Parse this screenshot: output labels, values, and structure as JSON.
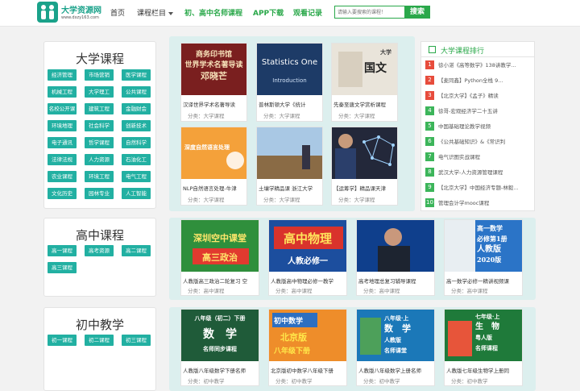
{
  "header": {
    "logo_title": "大学资源网",
    "logo_url": "www.dxzy163.com",
    "nav": {
      "home": "首页",
      "columns": "课程栏目",
      "famous": "初、高中名师课程",
      "app": "APP下载",
      "history": "观看记录"
    },
    "search_placeholder": "请输入要搜索的课程！",
    "search_button": "搜索"
  },
  "university": {
    "title": "大学课程",
    "tags": [
      "经济管理",
      "市场营销",
      "医学课程",
      "机械工程",
      "大学理工",
      "公共课程",
      "名校公开课",
      "建筑工程",
      "金融财会",
      "环境地理",
      "社会科学",
      "创新技术",
      "电子通讯",
      "哲学课程",
      "自然科学",
      "法律法规",
      "人力资源",
      "石油化工",
      "农业课程",
      "环境工程",
      "电气工程",
      "文化历史",
      "园林专业",
      "人工智能"
    ],
    "cards": [
      {
        "title": "汉译世界学术名著导读",
        "meta": "分类：大学课程",
        "thumb": "商务印书馆\n世界学术名著导读\n邓晓芒"
      },
      {
        "title": "普林斯顿大学《统计",
        "meta": "分类：大学课程",
        "thumb": "Statistics One",
        "thumb_sub": "Introduction"
      },
      {
        "title": "先秦至唐文学赏析课程",
        "meta": "分类：大学课程",
        "thumb": "国文",
        "thumb_sub": "大学"
      },
      {
        "title": "NLP自然语言处理-牛津",
        "meta": "分类：大学课程",
        "thumb": "深度自然语言处理"
      },
      {
        "title": "土壤学精品课 浙江大学",
        "meta": "分类：大学课程",
        "thumb": ""
      },
      {
        "title": "【运筹学】精品课天津",
        "meta": "分类：大学课程",
        "thumb": ""
      }
    ],
    "ranking": {
      "title": "大学课程排行",
      "items": [
        {
          "num": "1",
          "text": "徐小湛《高等数学》138讲教学..."
        },
        {
          "num": "2",
          "text": "【麦同鑫】Python全栈 9..."
        },
        {
          "num": "3",
          "text": "【北京大学】《孟子》精读"
        },
        {
          "num": "4",
          "text": "徐哥-宏观经济学二十五讲"
        },
        {
          "num": "5",
          "text": "中国基础理论教学视频"
        },
        {
          "num": "6",
          "text": "《公共基础知识》&《常识判"
        },
        {
          "num": "7",
          "text": "电气识图实战课程"
        },
        {
          "num": "8",
          "text": "武汉大学-人力资源管理课程"
        },
        {
          "num": "9",
          "text": "【北京大学】中国经济专题-林毅..."
        },
        {
          "num": "10",
          "text": "管理会计学mooc课程"
        }
      ]
    }
  },
  "highschool": {
    "title": "高中课程",
    "tags": [
      "高一课程",
      "高考资源",
      "高二课程",
      "高三课程"
    ],
    "cards": [
      {
        "title": "人教版高三政治二轮复习 空",
        "meta": "分类：高中课程",
        "thumb": "深圳空中课堂",
        "thumb_sub": "高三政治"
      },
      {
        "title": "人教版高中物理必修一教学",
        "meta": "分类：高中课程",
        "thumb": "高中物理",
        "thumb_sub": "人教必修一"
      },
      {
        "title": "高考地理总复习辅导课程",
        "meta": "分类：高中课程",
        "thumb": ""
      },
      {
        "title": "高一数学必修一精讲视频课",
        "meta": "分类：高中课程",
        "thumb": "高一数学\n必修第1册\n人教版\n2020版"
      }
    ]
  },
  "juniorhigh": {
    "title": "初中教学",
    "tags": [
      "初一课程",
      "初二课程",
      "初三课程"
    ],
    "cards": [
      {
        "title": "人教版八年级数学下册名师",
        "meta": "分类：初中教学",
        "thumb": "八年级（初二）下册\n数　学\n名师同步课程"
      },
      {
        "title": "北京版初中数学八年级下册",
        "meta": "分类：初中教学",
        "thumb": "初中数学\n北京版\n八年级下册"
      },
      {
        "title": "人教版八年级数学上册名师",
        "meta": "分类：初中教学",
        "thumb": "八年级·上\n数　学\n人教版\n名师课堂"
      },
      {
        "title": "人教版七年级生物学上册同",
        "meta": "分类：初中教学",
        "thumb": "七年级·上\n生　物\n粤人版\n名师课程"
      }
    ]
  },
  "colors": {
    "accent_green": "#2aa84a",
    "tag_teal": "#22b0a2",
    "rank_red": "#e74c3c",
    "rank_green": "#3cb55a"
  }
}
